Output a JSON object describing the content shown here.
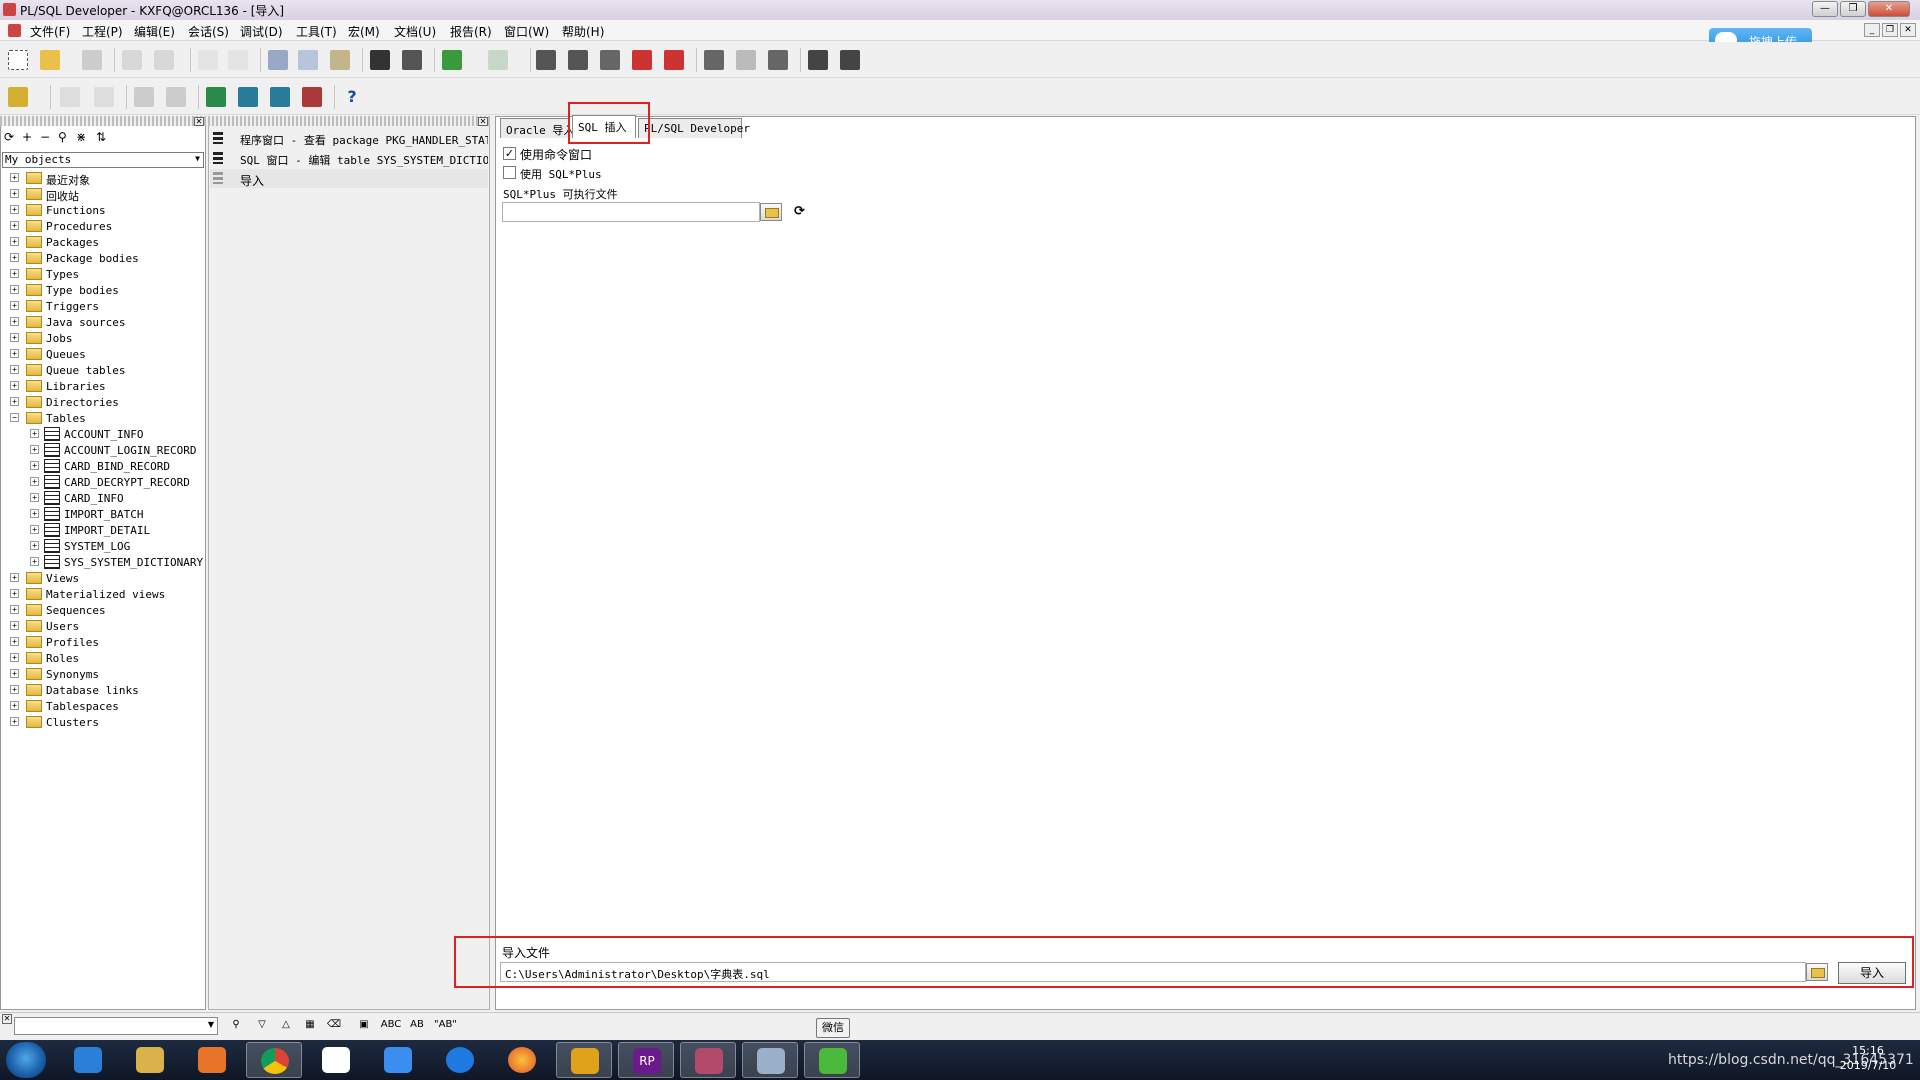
{
  "window": {
    "title": "PL/SQL Developer - KXFQ@ORCL136 - [导入]",
    "controls": [
      "—",
      "❐",
      "✕"
    ]
  },
  "menu": {
    "items": [
      "文件(F)",
      "工程(P)",
      "编辑(E)",
      "会话(S)",
      "调试(D)",
      "工具(T)",
      "宏(M)",
      "文档(U)",
      "报告(R)",
      "窗口(W)",
      "帮助(H)"
    ]
  },
  "upload_button": {
    "label": "拖拽上传"
  },
  "object_browser": {
    "selector_value": "My objects",
    "tree": [
      {
        "label": "最近对象",
        "expander": "+"
      },
      {
        "label": "回收站",
        "expander": "+"
      },
      {
        "label": "Functions",
        "expander": "+"
      },
      {
        "label": "Procedures",
        "expander": "+"
      },
      {
        "label": "Packages",
        "expander": "+"
      },
      {
        "label": "Package bodies",
        "expander": "+"
      },
      {
        "label": "Types",
        "expander": "+"
      },
      {
        "label": "Type bodies",
        "expander": "+"
      },
      {
        "label": "Triggers",
        "expander": "+"
      },
      {
        "label": "Java sources",
        "expander": "+"
      },
      {
        "label": "Jobs",
        "expander": "+"
      },
      {
        "label": "Queues",
        "expander": "+"
      },
      {
        "label": "Queue tables",
        "expander": "+"
      },
      {
        "label": "Libraries",
        "expander": "+"
      },
      {
        "label": "Directories",
        "expander": "+"
      },
      {
        "label": "Tables",
        "expander": "−"
      },
      {
        "label": "ACCOUNT_INFO",
        "expander": "+",
        "child": true
      },
      {
        "label": "ACCOUNT_LOGIN_RECORD",
        "expander": "+",
        "child": true
      },
      {
        "label": "CARD_BIND_RECORD",
        "expander": "+",
        "child": true
      },
      {
        "label": "CARD_DECRYPT_RECORD",
        "expander": "+",
        "child": true
      },
      {
        "label": "CARD_INFO",
        "expander": "+",
        "child": true
      },
      {
        "label": "IMPORT_BATCH",
        "expander": "+",
        "child": true
      },
      {
        "label": "IMPORT_DETAIL",
        "expander": "+",
        "child": true
      },
      {
        "label": "SYSTEM_LOG",
        "expander": "+",
        "child": true
      },
      {
        "label": "SYS_SYSTEM_DICTIONARY",
        "expander": "+",
        "child": true
      },
      {
        "label": "Views",
        "expander": "+"
      },
      {
        "label": "Materialized views",
        "expander": "+"
      },
      {
        "label": "Sequences",
        "expander": "+"
      },
      {
        "label": "Users",
        "expander": "+"
      },
      {
        "label": "Profiles",
        "expander": "+"
      },
      {
        "label": "Roles",
        "expander": "+"
      },
      {
        "label": "Synonyms",
        "expander": "+"
      },
      {
        "label": "Database links",
        "expander": "+"
      },
      {
        "label": "Tablespaces",
        "expander": "+"
      },
      {
        "label": "Clusters",
        "expander": "+"
      }
    ]
  },
  "window_list": {
    "items": [
      "程序窗口 - 查看 package PKG_HANDLER_STATUS",
      "SQL 窗口 - 编辑 table SYS_SYSTEM_DICTIONARY",
      "导入"
    ],
    "selected_index": 2
  },
  "import_window": {
    "tabs": [
      "Oracle 导入",
      "SQL 插入",
      "PL/SQL Developer"
    ],
    "active_tab": "SQL 插入",
    "use_command_window_label": "使用命令窗口",
    "use_command_window_checked": true,
    "use_sqlplus_label": "使用 SQL*Plus",
    "use_sqlplus_checked": false,
    "sqlplus_exe_label": "SQL*Plus 可执行文件",
    "sqlplus_exe_value": "",
    "import_file_label": "导入文件",
    "import_file_value": "C:\\Users\\Administrator\\Desktop\\字典表.sql",
    "import_button_label": "导入"
  },
  "findbar": {
    "search_value": "",
    "tooltip": "微信"
  },
  "taskbar": {
    "apps": [
      "ie-icon",
      "explorer-icon",
      "media-player-icon",
      "chrome-icon",
      "baidu-netdisk-icon",
      "feishu-icon",
      "kugou-icon",
      "firefox-icon",
      "filezilla-icon",
      "axure-rp-icon",
      "plsql-developer-icon",
      "notepad-icon",
      "wechat-icon"
    ],
    "rp_label": "RP",
    "tray_text": "https://blog.csdn.net/qq_31645371",
    "clock_time": "15:16",
    "clock_date": "2019/7/10"
  },
  "colors": {
    "highlight_box": "#e02020",
    "upload_button": "#2b8fe0"
  }
}
